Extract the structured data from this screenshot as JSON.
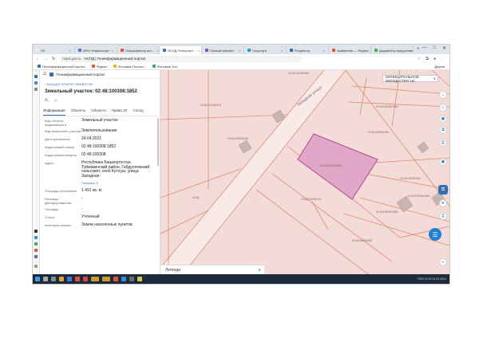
{
  "browser": {
    "tabs": [
      {
        "label": "VK",
        "fav": "#eeeeee",
        "active": false
      },
      {
        "label": "АРМ «Навигатор»",
        "fav": "#3d7be0",
        "active": false
      },
      {
        "label": "Пользователь вот ...",
        "fav": "#e0533b",
        "active": false
      },
      {
        "label": "НСПД Геопортал ...",
        "fav": "#2f6fb3",
        "active": true
      },
      {
        "label": "Личный кабинет",
        "fav": "#7b55c4",
        "active": false
      },
      {
        "label": "Госуслуги",
        "fav": "#2f8de4",
        "active": false
      },
      {
        "label": "Росреестр",
        "fav": "#2f6fb3",
        "active": false
      },
      {
        "label": "Заявление — Яндекс",
        "fav": "#e0533b",
        "active": false
      },
      {
        "label": "Документы предоставл...",
        "fav": "#3bb25a",
        "active": false
      }
    ],
    "new_tab": "+",
    "window_controls": [
      "—",
      "□",
      "✕"
    ],
    "url": "nspd.gov.ru",
    "page_title": "НСПД | Геоинформационный портал",
    "bookmarks": [
      {
        "label": "Геоинформационный портал",
        "color": "#2f6fb3"
      },
      {
        "label": "Яндекс",
        "color": "#e0533b"
      },
      {
        "label": "Фоновые Пользо...",
        "color": "#f0b400"
      },
      {
        "label": "Фоновые Зон",
        "color": "#3bb25a"
      }
    ],
    "bookmarks_right": "Другие"
  },
  "panel": {
    "header": "Геоинформационный портал",
    "back_link": "НАЗАД К СПИСКУ ОБЪЕКТОВ",
    "title": "Земельный участок: 02:48:100308:1852",
    "tabs": [
      "Информация",
      "Объекты",
      "Объекты",
      "Права ЗУ",
      "Сосед"
    ],
    "rows": [
      {
        "k": "Вид объекта недвижимости",
        "v": "Земельный участок",
        "link": false
      },
      {
        "k": "Вид земельного участка",
        "v": "Землепользование",
        "link": false
      },
      {
        "k": "Дата присвоения",
        "v": "24.04.2021",
        "link": false
      },
      {
        "k": "Кадастровый номер",
        "v": "02:48:100308:1852",
        "link": false
      },
      {
        "k": "Кадастровый квартал",
        "v": "02:48:100308",
        "link": false
      },
      {
        "k": "Адрес",
        "v": "Республика Башкортостан, Туймазинский район, Габдулловский сельсовет, село Кутлуш, улица Западная",
        "link": false
      },
      {
        "k": "",
        "v": "Показать ∨",
        "link": true
      },
      {
        "k": "Площадь уточненная",
        "v": "1 491 кв. м",
        "link": false
      },
      {
        "k": "Площадь декларированная",
        "v": "-",
        "link": false
      },
      {
        "k": "Площадь",
        "v": "-",
        "link": false
      },
      {
        "k": "Статус",
        "v": "Учтенный",
        "link": false
      },
      {
        "k": "Категория земель",
        "v": "Земли населенных пунктов",
        "link": false
      }
    ]
  },
  "map": {
    "category_select": "МУНИЦИПАЛЬНОЕ ИМУЩЕСТВО НС",
    "street": "Западная улица",
    "legend": "Легенда",
    "chev": "∧",
    "select_chev": "∨",
    "labels": [
      {
        "id": "l1",
        "text": "02:48:100308:456"
      },
      {
        "id": "l2",
        "text": "02:48:100308:475"
      },
      {
        "id": "l3",
        "text": "02:48:100308:1850"
      },
      {
        "id": "l4",
        "text": "02:48:100308:468"
      },
      {
        "id": "l5",
        "text": "02:48:100308:268"
      },
      {
        "id": "l6",
        "text": "02:48:100308:1852"
      },
      {
        "id": "l7",
        "text": "02:48:100308:300"
      },
      {
        "id": "l8",
        "text": "02:48:100308:311"
      },
      {
        "id": "l9",
        "text": "02:48:100308:1861"
      },
      {
        "id": "l10",
        "text": "02:48:100308:1853"
      },
      {
        "id": "l11",
        "text": "02:48:100308:857"
      },
      {
        "id": "l12",
        "text": "02:48"
      }
    ],
    "tools": [
      "⌂",
      "◇",
      "▣",
      "⧉",
      "⎙",
      "▣",
      "➤",
      "⎙",
      "+"
    ],
    "chat": "☰"
  },
  "taskbar": {
    "tray": "RUS  14:21  01.01.2024"
  },
  "colors": {
    "map_bg": "#f3dcd8",
    "parcel_line": "#e08a6d",
    "selected_fill": "#e2a6c8",
    "selected_stroke": "#b04a8a",
    "accent": "#2f6fb3"
  }
}
